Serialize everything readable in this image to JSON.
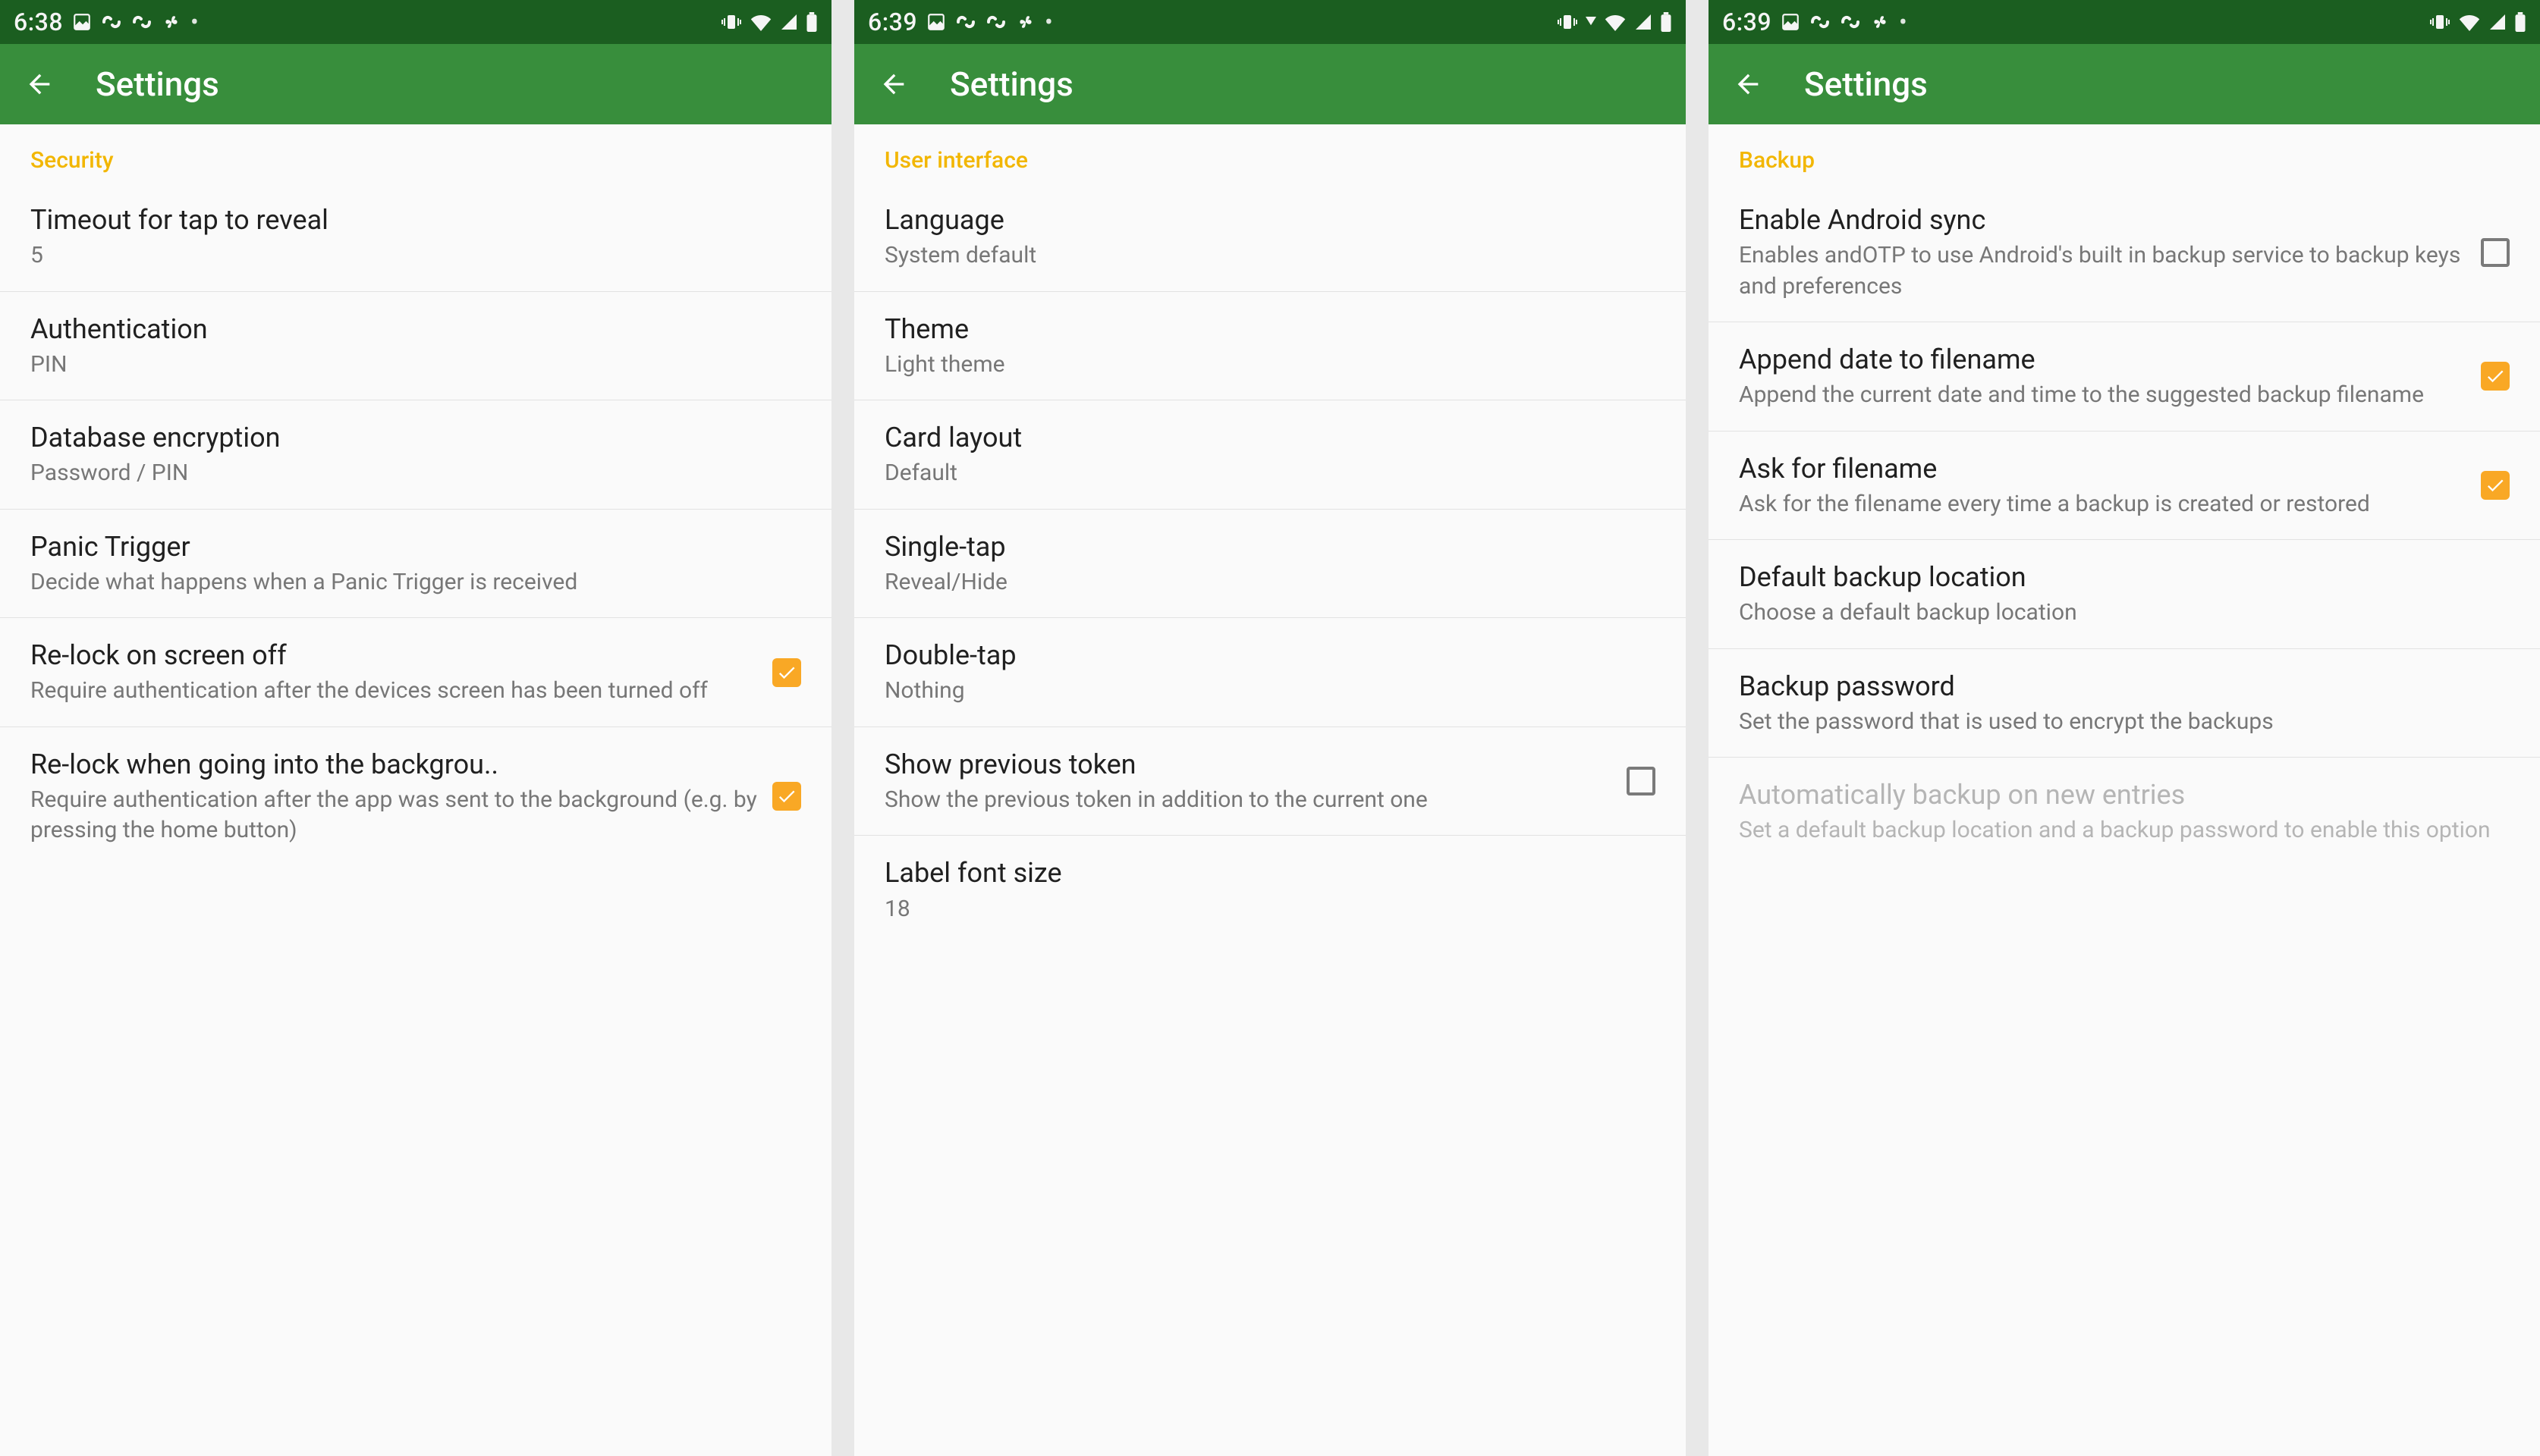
{
  "statusbar": {
    "times": [
      "6:38",
      "6:39",
      "6:39"
    ]
  },
  "appbar": {
    "title": "Settings"
  },
  "screens": [
    {
      "section": "Security",
      "items": [
        {
          "slug": "timeout-tap-reveal",
          "title": "Timeout for tap to reveal",
          "sub": "5"
        },
        {
          "slug": "authentication",
          "title": "Authentication",
          "sub": "PIN"
        },
        {
          "slug": "database-encryption",
          "title": "Database encryption",
          "sub": "Password / PIN"
        },
        {
          "slug": "panic-trigger",
          "title": "Panic Trigger",
          "sub": "Decide what happens when a Panic Trigger is received"
        },
        {
          "slug": "relock-screen-off",
          "title": "Re-lock on screen off",
          "sub": "Require authentication after the devices screen has been turned off",
          "checked": true
        },
        {
          "slug": "relock-background",
          "title": "Re-lock when going into the backgrou..",
          "title_nowrap": true,
          "sub": "Require authentication after the app was sent to the background (e.g. by pressing the home button)",
          "checked": true
        }
      ]
    },
    {
      "section": "User interface",
      "items": [
        {
          "slug": "language",
          "title": "Language",
          "sub": "System default"
        },
        {
          "slug": "theme",
          "title": "Theme",
          "sub": "Light theme"
        },
        {
          "slug": "card-layout",
          "title": "Card layout",
          "sub": "Default"
        },
        {
          "slug": "single-tap",
          "title": "Single-tap",
          "sub": "Reveal/Hide"
        },
        {
          "slug": "double-tap",
          "title": "Double-tap",
          "sub": "Nothing"
        },
        {
          "slug": "show-previous-token",
          "title": "Show previous token",
          "sub": "Show the previous token in addition to the current one",
          "checked": false
        },
        {
          "slug": "label-font-size",
          "title": "Label font size",
          "sub": "18"
        }
      ]
    },
    {
      "section": "Backup",
      "items": [
        {
          "slug": "enable-android-sync",
          "title": "Enable Android sync",
          "sub": "Enables andOTP to use Android's built in backup service to backup keys and preferences",
          "checked": false
        },
        {
          "slug": "append-date-filename",
          "title": "Append date to filename",
          "sub": "Append the current date and time to the suggested backup filename",
          "checked": true
        },
        {
          "slug": "ask-for-filename",
          "title": "Ask for filename",
          "sub": "Ask for the filename every time a backup is created or restored",
          "checked": true
        },
        {
          "slug": "default-backup-location",
          "title": "Default backup location",
          "sub": "Choose a default backup location"
        },
        {
          "slug": "backup-password",
          "title": "Backup password",
          "sub": "Set the password that is used to encrypt the backups"
        },
        {
          "slug": "auto-backup-new-entries",
          "title": "Automatically backup on new entries",
          "sub": "Set a default backup location and a backup password to enable this option",
          "disabled": true
        }
      ]
    }
  ]
}
